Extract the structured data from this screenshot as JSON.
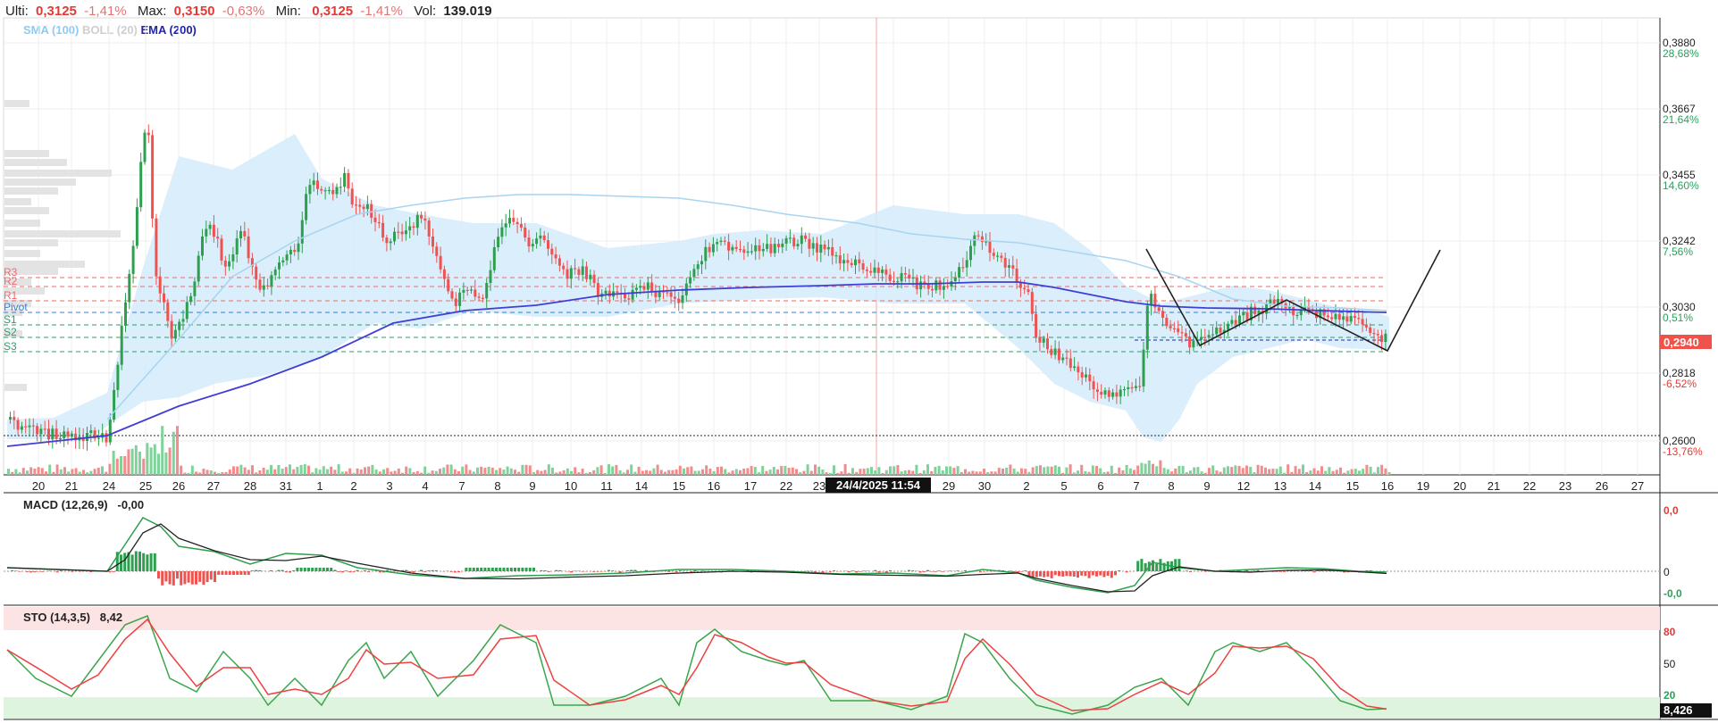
{
  "header": {
    "last_label": "Ulti:",
    "last_value": "0,3125",
    "last_pct": "-1,41%",
    "max_label": "Max:",
    "max_value": "0,3150",
    "max_pct": "-0,63%",
    "min_label": "Min:",
    "min_value": "0,3125",
    "min_pct": "-1,41%",
    "vol_label": "Vol:",
    "vol_value": "139.019"
  },
  "indicators": {
    "sma": "SMA (100)",
    "boll": "BOLL (20)",
    "ema": "EMA (200)"
  },
  "pivots": [
    "R3",
    "R2",
    "R1",
    "Pivot",
    "S1",
    "S2",
    "S3"
  ],
  "price_axis": [
    {
      "price": "0,3880",
      "pct": "28,68%"
    },
    {
      "price": "0,3667",
      "pct": "21,64%"
    },
    {
      "price": "0,3455",
      "pct": "14,60%"
    },
    {
      "price": "0,3242",
      "pct": "7,56%"
    },
    {
      "price": "0,3030",
      "pct": "0,51%"
    },
    {
      "price": "0,2818",
      "pct": "-6,52%"
    },
    {
      "price": "0,2600",
      "pct": "-13,76%"
    }
  ],
  "current_price_tag": "0,2940",
  "x_dates": [
    "20",
    "21",
    "24",
    "25",
    "26",
    "27",
    "28",
    "31",
    "1",
    "2",
    "3",
    "4",
    "7",
    "8",
    "9",
    "10",
    "11",
    "14",
    "15",
    "16",
    "17",
    "22",
    "23",
    "24",
    "29",
    "30",
    "2",
    "5",
    "6",
    "7",
    "8",
    "9",
    "12",
    "13",
    "14",
    "15",
    "16",
    "19",
    "20",
    "21",
    "22",
    "23",
    "26",
    "27"
  ],
  "crosshair_label": "24/4/2025 11:54",
  "macd": {
    "title": "MACD (12,26,9)",
    "value": "-0,00",
    "axis_top": "0,0",
    "axis_mid": "0",
    "axis_bottom": "-0,0"
  },
  "sto": {
    "title": "STO (14,3,5)",
    "value": "8,42",
    "axis_80": "80",
    "axis_50": "50",
    "axis_20": "20",
    "current_tag": "8,426"
  },
  "colors": {
    "up": "#2e9e4f",
    "down": "#ef5350",
    "ema": "#3f3fd6",
    "boll_fill": "#d3ebfb",
    "sma": "#a8d4f0"
  }
}
